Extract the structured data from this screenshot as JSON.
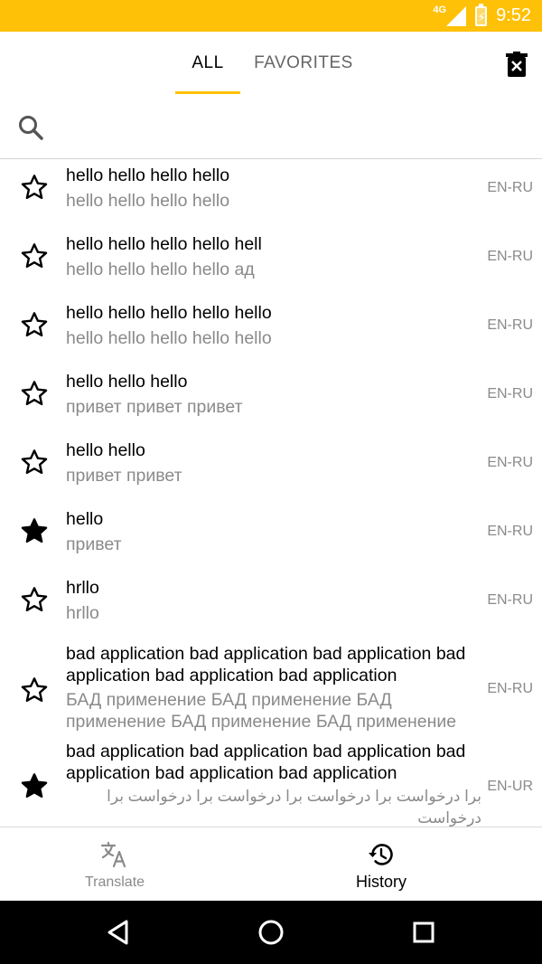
{
  "status_bar": {
    "network": "4G",
    "time": "9:52",
    "background_color": "#FFC107"
  },
  "tabs": {
    "all_label": "ALL",
    "favorites_label": "FAVORITES",
    "active": "ALL",
    "indicator_color": "#FFC107"
  },
  "search": {
    "placeholder": "",
    "value": ""
  },
  "history": [
    {
      "source": "hello hello hello hello",
      "translation": "hello hello hello hello",
      "lang": "EN-RU",
      "favorite": false
    },
    {
      "source": "hello hello hello hello hell",
      "translation": "hello hello hello hello ад",
      "lang": "EN-RU",
      "favorite": false
    },
    {
      "source": "hello hello hello hello hello",
      "translation": "hello hello hello hello hello",
      "lang": "EN-RU",
      "favorite": false
    },
    {
      "source": "hello hello hello",
      "translation": "привет привет привет",
      "lang": "EN-RU",
      "favorite": false
    },
    {
      "source": "hello hello",
      "translation": "привет привет",
      "lang": "EN-RU",
      "favorite": false
    },
    {
      "source": "hello",
      "translation": "привет",
      "lang": "EN-RU",
      "favorite": true
    },
    {
      "source": "hrllo",
      "translation": "hrllo",
      "lang": "EN-RU",
      "favorite": false
    },
    {
      "source": "bad application bad application bad application bad application bad application bad application",
      "translation": "БАД применение БАД применение БАД применение БАД применение БАД применение",
      "lang": "EN-RU",
      "favorite": false
    },
    {
      "source": "bad application bad application bad application bad application bad application bad application",
      "translation": "برا درخواست برا درخواست برا درخواست برا درخواست برا درخواست",
      "lang": "EN-UR",
      "favorite": true
    }
  ],
  "bottom_nav": {
    "translate_label": "Translate",
    "history_label": "History",
    "active": "History"
  },
  "icons": {
    "delete": "delete-icon",
    "search": "search-icon",
    "star_outline": "star-outline-icon",
    "star_filled": "star-filled-icon",
    "translate": "translate-icon",
    "history": "history-icon",
    "back": "back-icon",
    "home": "home-icon",
    "recent": "recent-apps-icon"
  }
}
